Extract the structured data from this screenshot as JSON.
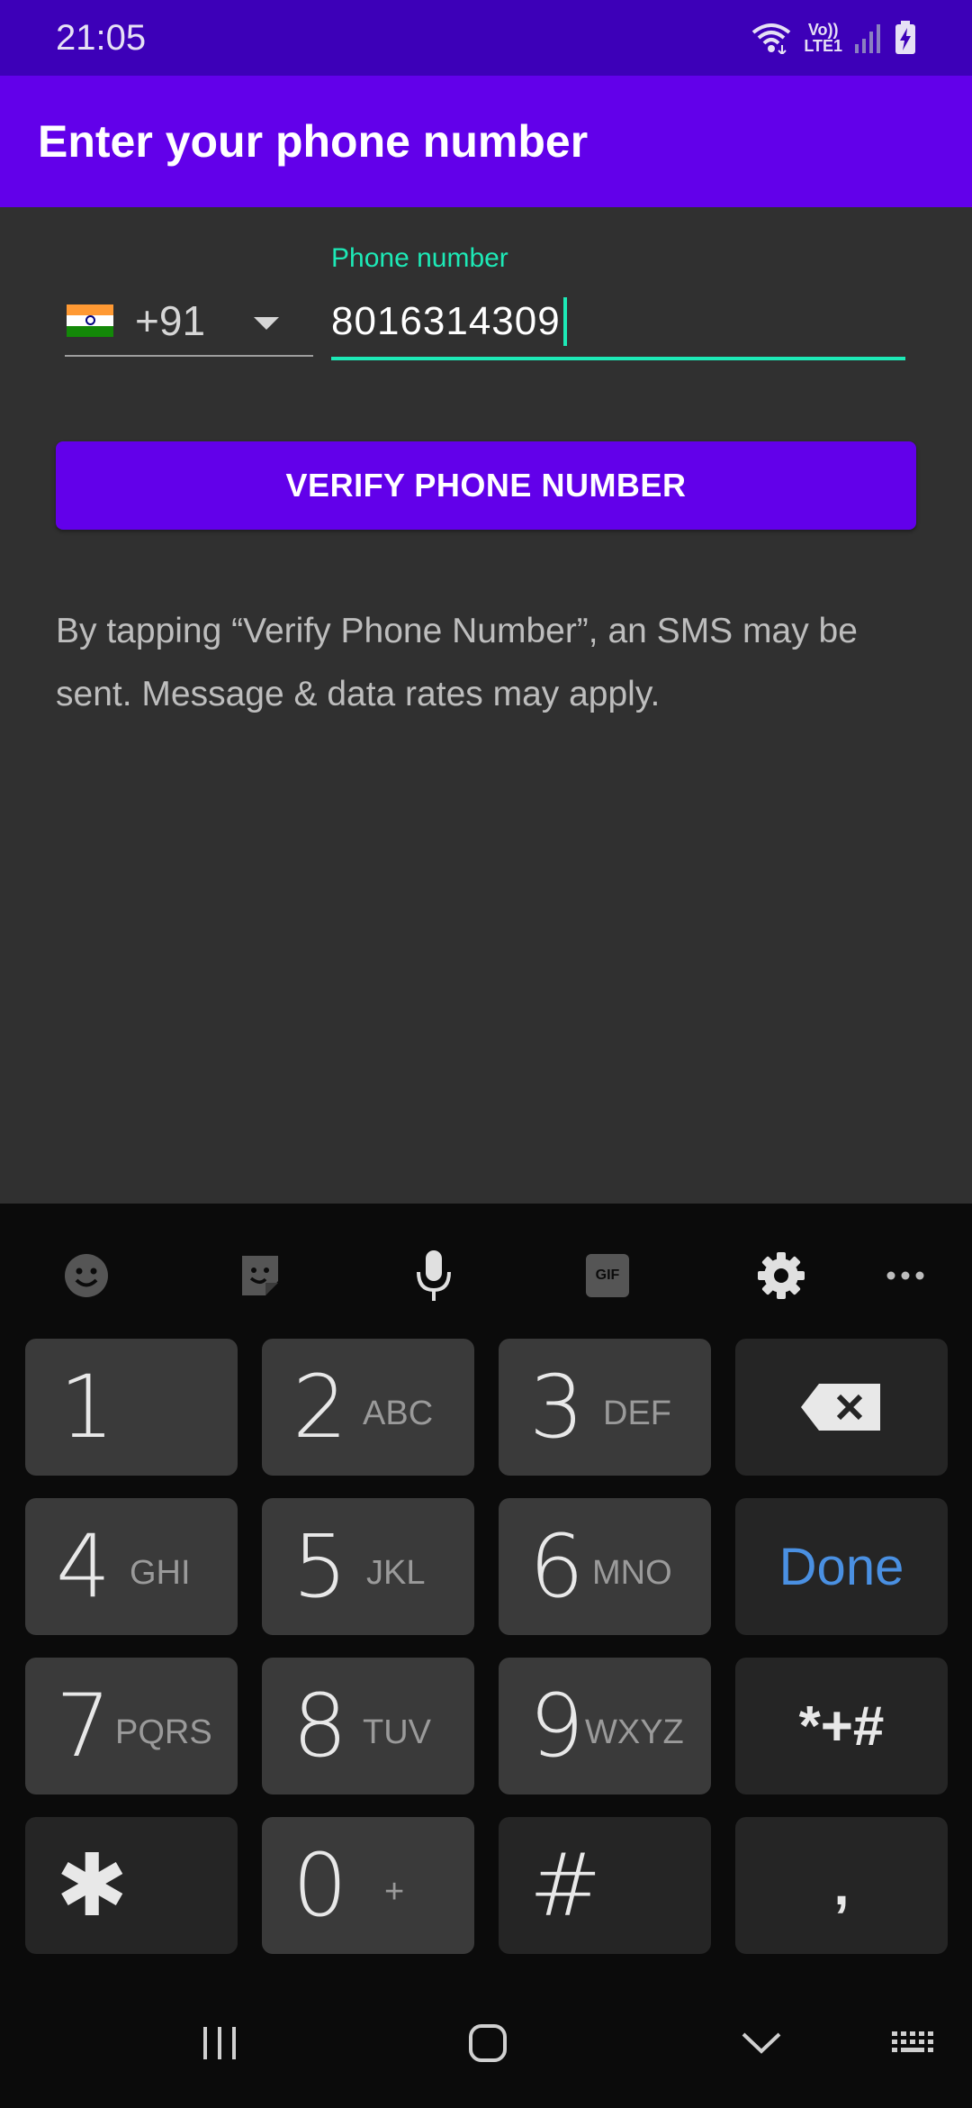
{
  "status_bar": {
    "time": "21:05",
    "network_label_top": "Vo))",
    "network_label_bottom": "LTE1",
    "icons": [
      "wifi-icon",
      "signal-icon",
      "battery-charging-icon"
    ]
  },
  "app_bar": {
    "title": "Enter your phone number"
  },
  "form": {
    "country_flag": "india-flag-icon",
    "country_code": "+91",
    "phone_label": "Phone number",
    "phone_value": "8016314309",
    "verify_button": "VERIFY PHONE NUMBER",
    "disclaimer": "By tapping “Verify Phone Number”, an SMS may be sent. Message & data rates may apply.",
    "accent_color": "#6200ea",
    "field_focus_color": "#1de9b6"
  },
  "keyboard": {
    "toolbar": [
      "emoji-icon",
      "sticker-icon",
      "microphone-icon",
      "gif-icon",
      "settings-gear-icon",
      "more-options-icon"
    ],
    "gif_label": "GIF",
    "keys": {
      "k1": {
        "num": "1",
        "letters": ""
      },
      "k2": {
        "num": "2",
        "letters": "ABC"
      },
      "k3": {
        "num": "3",
        "letters": "DEF"
      },
      "k4": {
        "num": "4",
        "letters": "GHI"
      },
      "k5": {
        "num": "5",
        "letters": "JKL"
      },
      "k6": {
        "num": "6",
        "letters": "MNO"
      },
      "k7": {
        "num": "7",
        "letters": "PQRS"
      },
      "k8": {
        "num": "8",
        "letters": "TUV"
      },
      "k9": {
        "num": "9",
        "letters": "WXYZ"
      },
      "kstar": {
        "num": "✱",
        "letters": ""
      },
      "k0": {
        "num": "0",
        "letters": "+"
      },
      "khash": {
        "num": "#",
        "letters": ""
      }
    },
    "done_label": "Done",
    "symbols_label": "*+#",
    "comma_label": ","
  },
  "nav_bar": {
    "buttons": [
      "recent-apps-icon",
      "home-icon",
      "back-icon",
      "keyboard-switch-icon"
    ]
  }
}
